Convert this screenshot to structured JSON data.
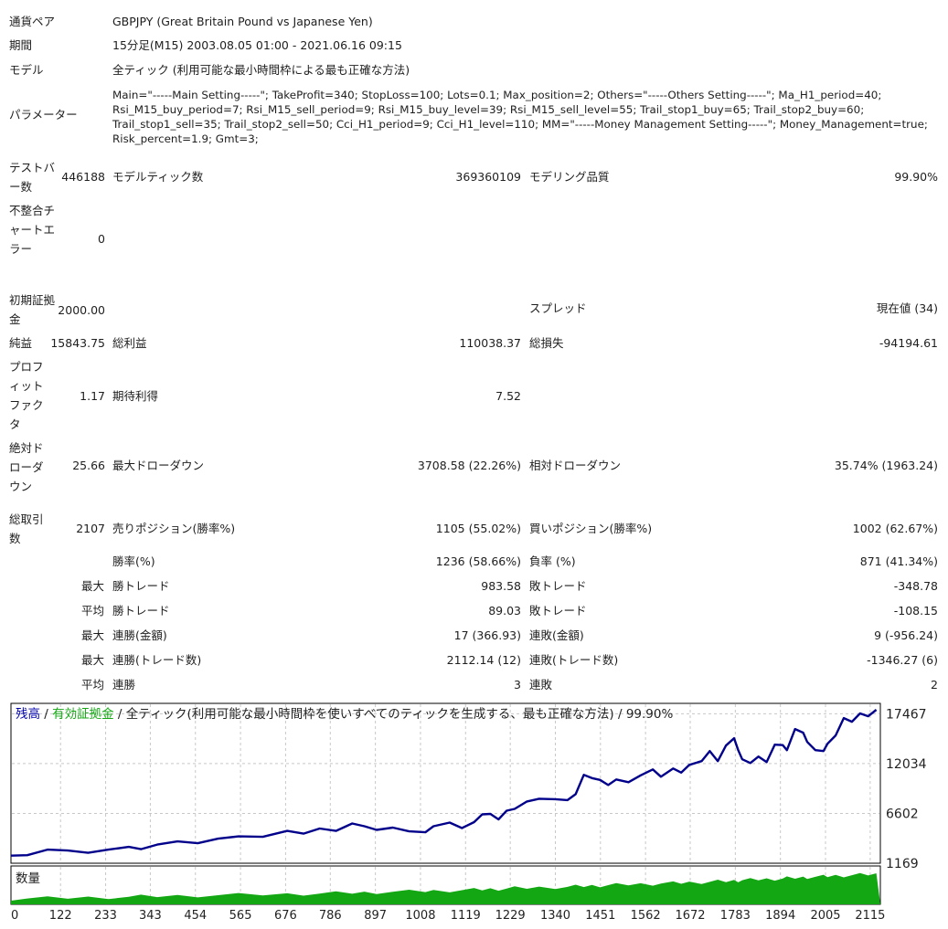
{
  "report": {
    "symbol": {
      "label": "通貨ペア",
      "value": "GBPJPY (Great Britain Pound vs Japanese Yen)"
    },
    "period": {
      "label": "期間",
      "value": "15分足(M15) 2003.08.05 01:00 - 2021.06.16 09:15"
    },
    "model": {
      "label": "モデル",
      "value": "全ティック (利用可能な最小時間枠による最も正確な方法)"
    },
    "parameters": {
      "label": "パラメーター",
      "value": "Main=\"-----Main Setting-----\"; TakeProfit=340; StopLoss=100; Lots=0.1; Max_position=2; Others=\"-----Others Setting-----\"; Ma_H1_period=40; Rsi_M15_buy_period=7; Rsi_M15_sell_period=9; Rsi_M15_buy_level=39; Rsi_M15_sell_level=55; Trail_stop1_buy=65; Trail_stop2_buy=60; Trail_stop1_sell=35; Trail_stop2_sell=50; Cci_H1_period=9; Cci_H1_level=110; MM=\"-----Money Management Setting-----\"; Money_Management=true; Risk_percent=1.9; Gmt=3;"
    },
    "test_bars": {
      "label": "テストバー数",
      "value": "446188"
    },
    "model_ticks": {
      "label": "モデルティック数",
      "value": "369360109"
    },
    "modeling_quality": {
      "label": "モデリング品質",
      "value": "99.90%"
    },
    "mismatch_errors": {
      "label": "不整合チャートエラー",
      "value": "0"
    },
    "initial_deposit": {
      "label": "初期証拠金",
      "value": "2000.00"
    },
    "spread": {
      "label": "スプレッド",
      "value": "現在値 (34)"
    },
    "net_profit": {
      "label": "純益",
      "value": "15843.75"
    },
    "gross_profit": {
      "label": "総利益",
      "value": "110038.37"
    },
    "gross_loss": {
      "label": "総損失",
      "value": "-94194.61"
    },
    "profit_factor": {
      "label": "プロフィットファクタ",
      "value": "1.17"
    },
    "expected_payoff": {
      "label": "期待利得",
      "value": "7.52"
    },
    "absolute_drawdown": {
      "label": "絶対ドローダウン",
      "value": "25.66"
    },
    "maximal_drawdown": {
      "label": "最大ドローダウン",
      "value": "3708.58 (22.26%)"
    },
    "relative_drawdown": {
      "label": "相対ドローダウン",
      "value": "35.74% (1963.24)"
    },
    "total_trades": {
      "label": "総取引数",
      "value": "2107"
    },
    "short_positions": {
      "label": "売りポジション(勝率%)",
      "value": "1105 (55.02%)"
    },
    "long_positions": {
      "label": "買いポジション(勝率%)",
      "value": "1002 (62.67%)"
    },
    "win_rate": {
      "label": "勝率(%)",
      "value": "1236 (58.66%)"
    },
    "loss_rate": {
      "label": "負率 (%)",
      "value": "871 (41.34%)"
    },
    "largest": {
      "prefix": "最大",
      "win_label": "勝トレード",
      "win_value": "983.58",
      "loss_label": "敗トレード",
      "loss_value": "-348.78"
    },
    "average": {
      "prefix": "平均",
      "win_label": "勝トレード",
      "win_value": "89.03",
      "loss_label": "敗トレード",
      "loss_value": "-108.15"
    },
    "max_consec_amount": {
      "prefix": "最大",
      "win_label": "連勝(金額)",
      "win_value": "17 (366.93)",
      "loss_label": "連敗(金額)",
      "loss_value": "9 (-956.24)"
    },
    "max_consec_trades": {
      "prefix": "最大",
      "win_label": "連勝(トレード数)",
      "win_value": "2112.14 (12)",
      "loss_label": "連敗(トレード数)",
      "loss_value": "-1346.27 (6)"
    },
    "avg_consec": {
      "prefix": "平均",
      "win_label": "連勝",
      "win_value": "3",
      "loss_label": "連敗",
      "loss_value": "2"
    }
  },
  "chart_data": {
    "type": "line",
    "title_balance": "残高",
    "title_sep1": " / ",
    "title_equity": "有効証拠金",
    "title_rest": " / 全ティック(利用可能な最小時間枠を使いすべてのティックを生成する、最も正確な方法) / 99.90%",
    "volume_label": "数量",
    "y_ticks": [
      "17467",
      "12034",
      "6602",
      "1169"
    ],
    "x_ticks": [
      "0",
      "122",
      "233",
      "343",
      "454",
      "565",
      "676",
      "786",
      "897",
      "1008",
      "1119",
      "1229",
      "1340",
      "1451",
      "1562",
      "1672",
      "1783",
      "1894",
      "2005",
      "2115"
    ],
    "xlim": [
      0,
      2140
    ],
    "ylim": [
      1169,
      18600
    ],
    "balance_color": "#00008b",
    "equity_color": "#13a813",
    "grid_color": "#c8c8c8",
    "series": [
      {
        "name": "残高",
        "x": [
          0,
          40,
          90,
          140,
          190,
          240,
          290,
          320,
          360,
          410,
          460,
          510,
          560,
          620,
          680,
          720,
          760,
          800,
          840,
          870,
          900,
          940,
          980,
          1020,
          1040,
          1080,
          1110,
          1140,
          1160,
          1180,
          1200,
          1220,
          1240,
          1270,
          1300,
          1340,
          1370,
          1390,
          1410,
          1430,
          1450,
          1470,
          1490,
          1520,
          1550,
          1580,
          1600,
          1630,
          1650,
          1670,
          1700,
          1720,
          1740,
          1760,
          1780,
          1790,
          1800,
          1820,
          1840,
          1860,
          1880,
          1900,
          1910,
          1930,
          1950,
          1960,
          1980,
          2000,
          2010,
          2030,
          2050,
          2070,
          2090,
          2110,
          2130
        ],
        "y": [
          2000,
          2050,
          2650,
          2550,
          2300,
          2650,
          2950,
          2700,
          3200,
          3550,
          3350,
          3850,
          4100,
          4050,
          4700,
          4400,
          4950,
          4700,
          5500,
          5200,
          4800,
          5050,
          4650,
          4550,
          5200,
          5600,
          5000,
          5650,
          6500,
          6550,
          5950,
          6900,
          7100,
          7900,
          8200,
          8150,
          8050,
          8700,
          10800,
          10450,
          10250,
          9700,
          10300,
          10000,
          10750,
          11400,
          10600,
          11500,
          11050,
          11900,
          12300,
          13400,
          12300,
          14000,
          14800,
          13500,
          12500,
          12100,
          12800,
          12200,
          14100,
          14050,
          13500,
          15800,
          15400,
          14400,
          13500,
          13400,
          14200,
          15100,
          17000,
          16600,
          17500,
          17200,
          17900
        ]
      }
    ]
  }
}
